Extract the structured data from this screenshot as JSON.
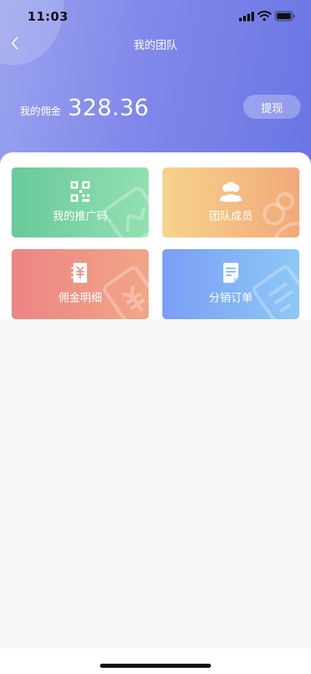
{
  "status_bar": {
    "time": "11:03",
    "icons": [
      "signal-icon",
      "wifi-icon",
      "battery-icon"
    ]
  },
  "nav": {
    "title": "我的团队",
    "back_icon": "chevron-left-icon"
  },
  "balance": {
    "label": "我的佣金",
    "value": "328.36",
    "withdraw_label": "提现"
  },
  "cards": [
    {
      "label": "我的推广码",
      "icon": "qr-code-icon",
      "colors": [
        "#69c99a",
        "#92e0b1"
      ]
    },
    {
      "label": "团队成员",
      "icon": "team-members-icon",
      "colors": [
        "#f7d38b",
        "#f1a97a"
      ]
    },
    {
      "label": "佣金明细",
      "icon": "commission-book-icon",
      "colors": [
        "#ec8484",
        "#f1a687"
      ]
    },
    {
      "label": "分销订单",
      "icon": "order-document-icon",
      "colors": [
        "#7a9ef4",
        "#8dc8f6"
      ]
    }
  ],
  "theme": {
    "header_gradient": [
      "#9aa3ef",
      "#6a76e4"
    ],
    "page_background": "#f8f8f8"
  }
}
